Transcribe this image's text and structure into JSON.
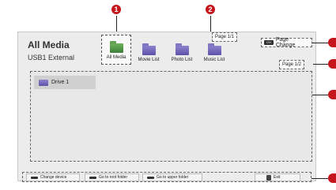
{
  "header": {
    "title": "All Media",
    "subtitle": "USB1 External"
  },
  "tabs": [
    {
      "label": "All Media",
      "selected": true
    },
    {
      "label": "Movie List",
      "selected": false
    },
    {
      "label": "Photo List",
      "selected": false
    },
    {
      "label": "Music List",
      "selected": false
    }
  ],
  "category_page": "Page 1/1",
  "page_change": {
    "key": "CH",
    "label": "Page Change"
  },
  "content_page": "Page 1/2",
  "items": [
    {
      "label": "Drive 1",
      "icon": "folder-icon"
    }
  ],
  "bottom_buttons": [
    {
      "label": "Change device"
    },
    {
      "label": "Go to root folder"
    },
    {
      "label": "Go to upper folder"
    },
    {
      "label": "Exit"
    }
  ],
  "callouts": [
    "1",
    "2"
  ],
  "colors": {
    "callout": "#c4161c",
    "folder": "#6b61b8",
    "selected_folder": "#4e8f43"
  }
}
